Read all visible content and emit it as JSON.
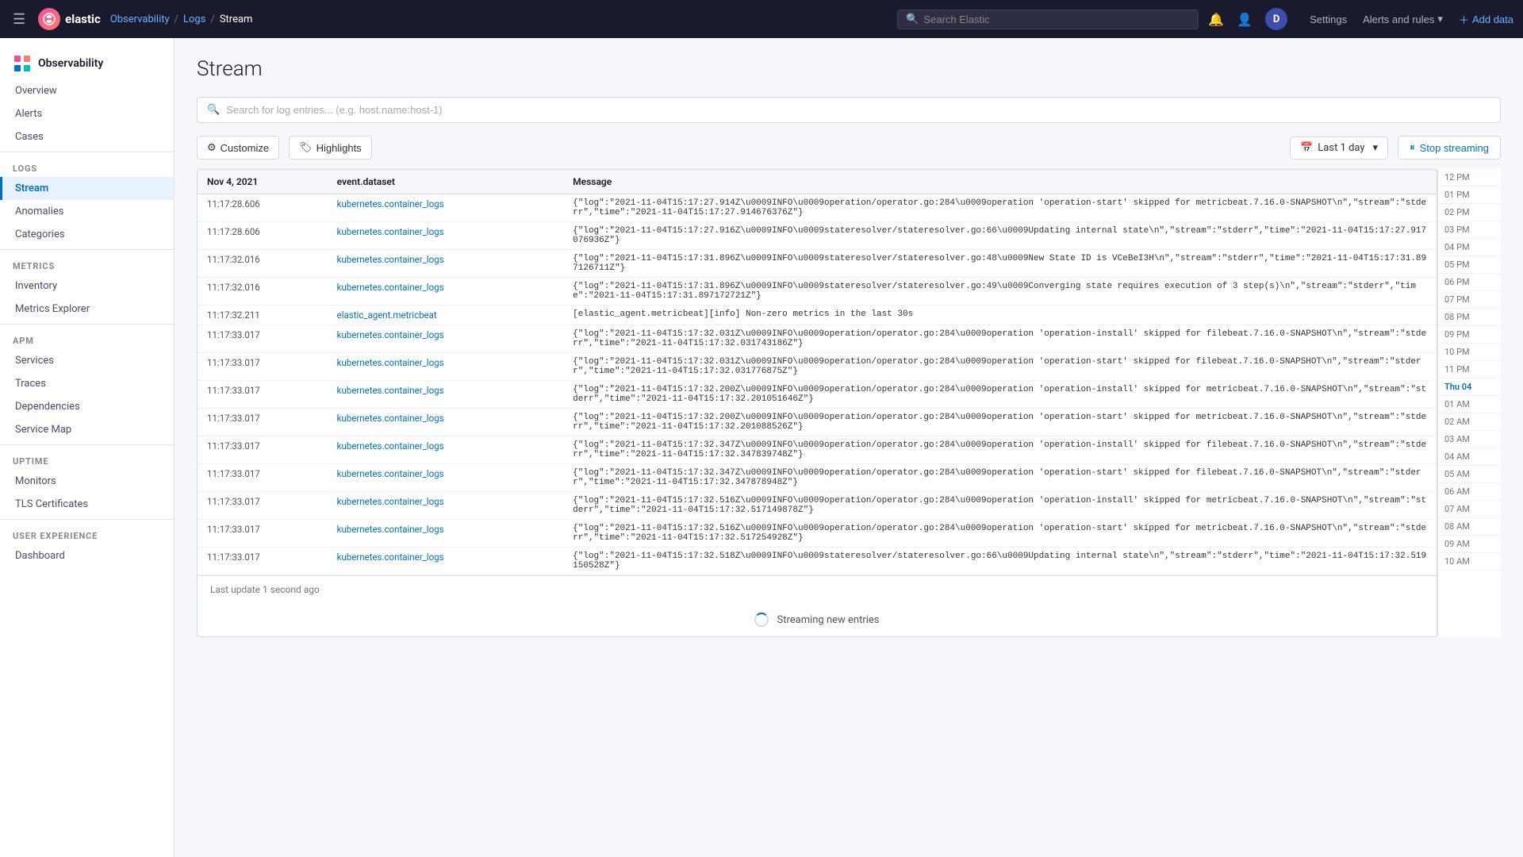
{
  "topnav": {
    "logo_text": "elastic",
    "logo_initial": "e",
    "user_initial": "D",
    "search_placeholder": "Search Elastic",
    "settings_label": "Settings",
    "alerts_rules_label": "Alerts and rules",
    "add_data_label": "Add data",
    "breadcrumbs": [
      {
        "label": "Observability",
        "active": false
      },
      {
        "label": "Logs",
        "active": false
      },
      {
        "label": "Stream",
        "active": true
      }
    ]
  },
  "sidebar": {
    "title": "Observability",
    "sections": [
      {
        "items": [
          {
            "label": "Overview",
            "id": "overview",
            "active": false
          },
          {
            "label": "Alerts",
            "id": "alerts",
            "active": false
          },
          {
            "label": "Cases",
            "id": "cases",
            "active": false
          }
        ]
      },
      {
        "section_label": "Logs",
        "items": [
          {
            "label": "Stream",
            "id": "stream",
            "active": true
          },
          {
            "label": "Anomalies",
            "id": "anomalies",
            "active": false
          },
          {
            "label": "Categories",
            "id": "categories",
            "active": false
          }
        ]
      },
      {
        "section_label": "Metrics",
        "items": [
          {
            "label": "Inventory",
            "id": "inventory",
            "active": false
          },
          {
            "label": "Metrics Explorer",
            "id": "metrics-explorer",
            "active": false
          }
        ]
      },
      {
        "section_label": "APM",
        "items": [
          {
            "label": "Services",
            "id": "services",
            "active": false
          },
          {
            "label": "Traces",
            "id": "traces",
            "active": false
          },
          {
            "label": "Dependencies",
            "id": "dependencies",
            "active": false
          },
          {
            "label": "Service Map",
            "id": "service-map",
            "active": false
          }
        ]
      },
      {
        "section_label": "Uptime",
        "items": [
          {
            "label": "Monitors",
            "id": "monitors",
            "active": false
          },
          {
            "label": "TLS Certificates",
            "id": "tls",
            "active": false
          }
        ]
      },
      {
        "section_label": "User Experience",
        "items": [
          {
            "label": "Dashboard",
            "id": "dashboard",
            "active": false
          }
        ]
      }
    ]
  },
  "main": {
    "page_title": "Stream",
    "search_placeholder": "Search for log entries... (e.g. host.name:host-1)",
    "customize_label": "Customize",
    "highlights_label": "Highlights",
    "date_range_label": "Last 1 day",
    "stop_streaming_label": "Stop streaming",
    "table": {
      "date_header": "Nov 4, 2021",
      "columns": [
        "",
        "event.dataset",
        "Message"
      ],
      "rows": [
        {
          "time": "11:17:28.606",
          "dataset": "kubernetes.container_logs",
          "message": "{\"log\":\"2021-11-04T15:17:27.914Z\\u0009INFO\\u0009operation/operator.go:284\\u0009operation 'operation-start' skipped for metricbeat.7.16.0-SNAPSHOT\\n\",\"stream\":\"stderr\",\"time\":\"2021-11-04T15:17:27.914676376Z\"}"
        },
        {
          "time": "11:17:28.606",
          "dataset": "kubernetes.container_logs",
          "message": "{\"log\":\"2021-11-04T15:17:27.916Z\\u0009INFO\\u0009stateresolver/stateresolver.go:66\\u0009Updating internal state\\n\",\"stream\":\"stderr\",\"time\":\"2021-11-04T15:17:27.917076936Z\"}"
        },
        {
          "time": "11:17:32.016",
          "dataset": "kubernetes.container_logs",
          "message": "{\"log\":\"2021-11-04T15:17:31.896Z\\u0009INFO\\u0009stateresolver/stateresolver.go:48\\u0009New State ID is VCeBeI3H\\n\",\"stream\":\"stderr\",\"time\":\"2021-11-04T15:17:31.897126711Z\"}"
        },
        {
          "time": "11:17:32.016",
          "dataset": "kubernetes.container_logs",
          "message": "{\"log\":\"2021-11-04T15:17:31.896Z\\u0009INFO\\u0009stateresolver/stateresolver.go:49\\u0009Converging state requires execution of 3 step(s)\\n\",\"stream\":\"stderr\",\"time\":\"2021-11-04T15:17:31.897172721Z\"}"
        },
        {
          "time": "11:17:32.211",
          "dataset": "elastic_agent.metricbeat",
          "message": "[elastic_agent.metricbeat][info] Non-zero metrics in the last 30s"
        },
        {
          "time": "11:17:33.017",
          "dataset": "kubernetes.container_logs",
          "message": "{\"log\":\"2021-11-04T15:17:32.031Z\\u0009INFO\\u0009operation/operator.go:284\\u0009operation 'operation-install' skipped for filebeat.7.16.0-SNAPSHOT\\n\",\"stream\":\"stderr\",\"time\":\"2021-11-04T15:17:32.031743186Z\"}"
        },
        {
          "time": "11:17:33.017",
          "dataset": "kubernetes.container_logs",
          "message": "{\"log\":\"2021-11-04T15:17:32.031Z\\u0009INFO\\u0009operation/operator.go:284\\u0009operation 'operation-start' skipped for filebeat.7.16.0-SNAPSHOT\\n\",\"stream\":\"stderr\",\"time\":\"2021-11-04T15:17:32.031776875Z\"}"
        },
        {
          "time": "11:17:33.017",
          "dataset": "kubernetes.container_logs",
          "message": "{\"log\":\"2021-11-04T15:17:32.200Z\\u0009INFO\\u0009operation/operator.go:284\\u0009operation 'operation-install' skipped for metricbeat.7.16.0-SNAPSHOT\\n\",\"stream\":\"stderr\",\"time\":\"2021-11-04T15:17:32.201051646Z\"}"
        },
        {
          "time": "11:17:33.017",
          "dataset": "kubernetes.container_logs",
          "message": "{\"log\":\"2021-11-04T15:17:32.200Z\\u0009INFO\\u0009operation/operator.go:284\\u0009operation 'operation-start' skipped for metricbeat.7.16.0-SNAPSHOT\\n\",\"stream\":\"stderr\",\"time\":\"2021-11-04T15:17:32.201088526Z\"}"
        },
        {
          "time": "11:17:33.017",
          "dataset": "kubernetes.container_logs",
          "message": "{\"log\":\"2021-11-04T15:17:32.347Z\\u0009INFO\\u0009operation/operator.go:284\\u0009operation 'operation-install' skipped for filebeat.7.16.0-SNAPSHOT\\n\",\"stream\":\"stderr\",\"time\":\"2021-11-04T15:17:32.347839748Z\"}"
        },
        {
          "time": "11:17:33.017",
          "dataset": "kubernetes.container_logs",
          "message": "{\"log\":\"2021-11-04T15:17:32.347Z\\u0009INFO\\u0009operation/operator.go:284\\u0009operation 'operation-start' skipped for filebeat.7.16.0-SNAPSHOT\\n\",\"stream\":\"stderr\",\"time\":\"2021-11-04T15:17:32.347878948Z\"}"
        },
        {
          "time": "11:17:33.017",
          "dataset": "kubernetes.container_logs",
          "message": "{\"log\":\"2021-11-04T15:17:32.516Z\\u0009INFO\\u0009operation/operator.go:284\\u0009operation 'operation-install' skipped for metricbeat.7.16.0-SNAPSHOT\\n\",\"stream\":\"stderr\",\"time\":\"2021-11-04T15:17:32.517149878Z\"}"
        },
        {
          "time": "11:17:33.017",
          "dataset": "kubernetes.container_logs",
          "message": "{\"log\":\"2021-11-04T15:17:32.516Z\\u0009INFO\\u0009operation/operator.go:284\\u0009operation 'operation-start' skipped for metricbeat.7.16.0-SNAPSHOT\\n\",\"stream\":\"stderr\",\"time\":\"2021-11-04T15:17:32.517254928Z\"}"
        },
        {
          "time": "11:17:33.017",
          "dataset": "kubernetes.container_logs",
          "message": "{\"log\":\"2021-11-04T15:17:32.518Z\\u0009INFO\\u0009stateresolver/stateresolver.go:66\\u0009Updating internal state\\n\",\"stream\":\"stderr\",\"time\":\"2021-11-04T15:17:32.519150528Z\"}"
        }
      ]
    },
    "footer": {
      "last_update": "Last update 1 second ago",
      "streaming_label": "Streaming new entries"
    }
  },
  "timeline": {
    "times": [
      "12 PM",
      "01 PM",
      "02 PM",
      "03 PM",
      "04 PM",
      "05 PM",
      "06 PM",
      "07 PM",
      "08 PM",
      "09 PM",
      "10 PM",
      "11 PM",
      "Thu 04",
      "01 AM",
      "02 AM",
      "03 AM",
      "04 AM",
      "05 AM",
      "06 AM",
      "07 AM",
      "08 AM",
      "09 AM",
      "10 AM"
    ]
  }
}
